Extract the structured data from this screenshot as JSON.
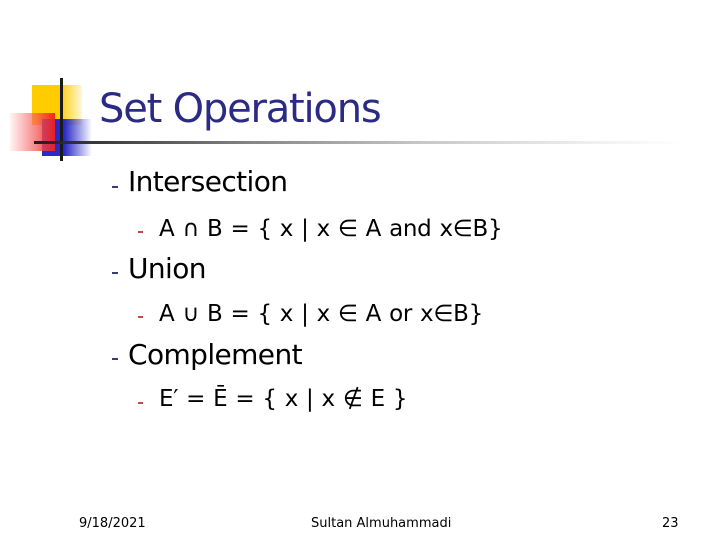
{
  "slide": {
    "title": "Set Operations",
    "bullets": [
      {
        "label": "Intersection",
        "sub": [
          "A ∩ B = { x | x ∈ A and x∈B}"
        ]
      },
      {
        "label": "Union",
        "sub": [
          "A ∪ B = { x | x ∈ A or x∈B}"
        ]
      },
      {
        "label": "Complement",
        "sub": [
          "E′ = Ē = { x | x ∉ E }"
        ]
      }
    ],
    "footer": {
      "date": "9/18/2021",
      "author": "Sultan Almuhammadi",
      "page_number": "23"
    },
    "colors": {
      "title": "#2b2b85",
      "bullet_level1": "#3b3b7a",
      "bullet_level2": "#c04a4a",
      "logo_yellow": "#ffcc00",
      "logo_blue": "#2a2ac8",
      "logo_red": "#f01e1e"
    }
  }
}
